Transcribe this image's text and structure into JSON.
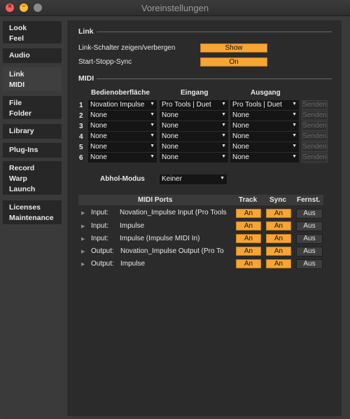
{
  "window": {
    "title": "Voreinstellungen"
  },
  "sidebar": {
    "items": [
      {
        "label": "Look\nFeel"
      },
      {
        "label": "Audio"
      },
      {
        "label": "Link\nMIDI"
      },
      {
        "label": "File\nFolder"
      },
      {
        "label": "Library"
      },
      {
        "label": "Plug-Ins"
      },
      {
        "label": "Record\nWarp\nLaunch"
      },
      {
        "label": "Licenses\nMaintenance"
      }
    ]
  },
  "link": {
    "heading": "Link",
    "toggle_label": "Link-Schalter zeigen/verbergen",
    "toggle_value": "Show",
    "sync_label": "Start-Stopp-Sync",
    "sync_value": "On"
  },
  "midi": {
    "heading": "MIDI",
    "col_surface": "Bedienoberfläche",
    "col_input": "Eingang",
    "col_output": "Ausgang",
    "rows": [
      {
        "num": "1",
        "surface": "Novation Impulse",
        "input": "Pro Tools | Duet",
        "output": "Pro Tools | Duet",
        "send": "Senden"
      },
      {
        "num": "2",
        "surface": "None",
        "input": "None",
        "output": "None",
        "send": "Senden"
      },
      {
        "num": "3",
        "surface": "None",
        "input": "None",
        "output": "None",
        "send": "Senden"
      },
      {
        "num": "4",
        "surface": "None",
        "input": "None",
        "output": "None",
        "send": "Senden"
      },
      {
        "num": "5",
        "surface": "None",
        "input": "None",
        "output": "None",
        "send": "Senden"
      },
      {
        "num": "6",
        "surface": "None",
        "input": "None",
        "output": "None",
        "send": "Senden"
      }
    ],
    "pickup_label": "Abhol-Modus",
    "pickup_value": "Keiner"
  },
  "ports": {
    "header": {
      "name": "MIDI Ports",
      "track": "Track",
      "sync": "Sync",
      "remote": "Fernst."
    },
    "rows": [
      {
        "dir": "Input:",
        "name": "Novation_Impulse Input (Pro Tools",
        "track": "An",
        "sync": "An",
        "remote": "Aus"
      },
      {
        "dir": "Input:",
        "name": "Impulse",
        "track": "An",
        "sync": "An",
        "remote": "Aus"
      },
      {
        "dir": "Input:",
        "name": "Impulse (Impulse MIDI In)",
        "track": "An",
        "sync": "An",
        "remote": "Aus"
      },
      {
        "dir": "Output:",
        "name": "Novation_Impulse Output (Pro To",
        "track": "An",
        "sync": "An",
        "remote": "Aus"
      },
      {
        "dir": "Output:",
        "name": "Impulse",
        "track": "An",
        "sync": "An",
        "remote": "Aus"
      }
    ]
  },
  "colors": {
    "accent": "#f7a533",
    "panel": "#2b2b2b",
    "background": "#3a3a3a"
  }
}
